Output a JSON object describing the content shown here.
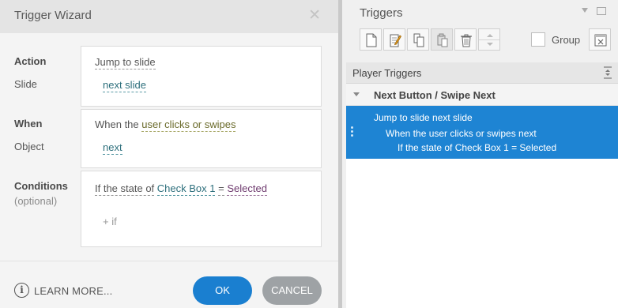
{
  "wizard": {
    "title": "Trigger Wizard",
    "close_glyph": "✕",
    "action_label": "Action",
    "action_value": "Jump to slide",
    "slide_label": "Slide",
    "slide_value": "next slide",
    "when_label": "When",
    "when_prefix": "When the",
    "when_value": "user clicks or swipes",
    "object_label": "Object",
    "object_value": "next",
    "conditions_label": "Conditions",
    "conditions_optional": "(optional)",
    "condition": {
      "prefix": "If the state of",
      "object": "Check Box 1",
      "operator": "=",
      "state": "Selected"
    },
    "add_if": "+ if",
    "info_glyph": "i",
    "learn_more": "LEARN MORE...",
    "ok_label": "OK",
    "cancel_label": "CANCEL"
  },
  "triggers_panel": {
    "title": "Triggers",
    "group_label": "Group",
    "player_triggers_label": "Player Triggers",
    "group_row_label": "Next Button / Swipe Next",
    "selected_trigger": {
      "line1": "Jump to slide next slide",
      "line2": "When the user clicks or swipes next",
      "line3": "If the state of Check Box 1 = Selected"
    }
  },
  "colors": {
    "accent_blue": "#1e84d3",
    "ok_button": "#1a7fd0",
    "cancel_button": "#9ea2a5"
  }
}
